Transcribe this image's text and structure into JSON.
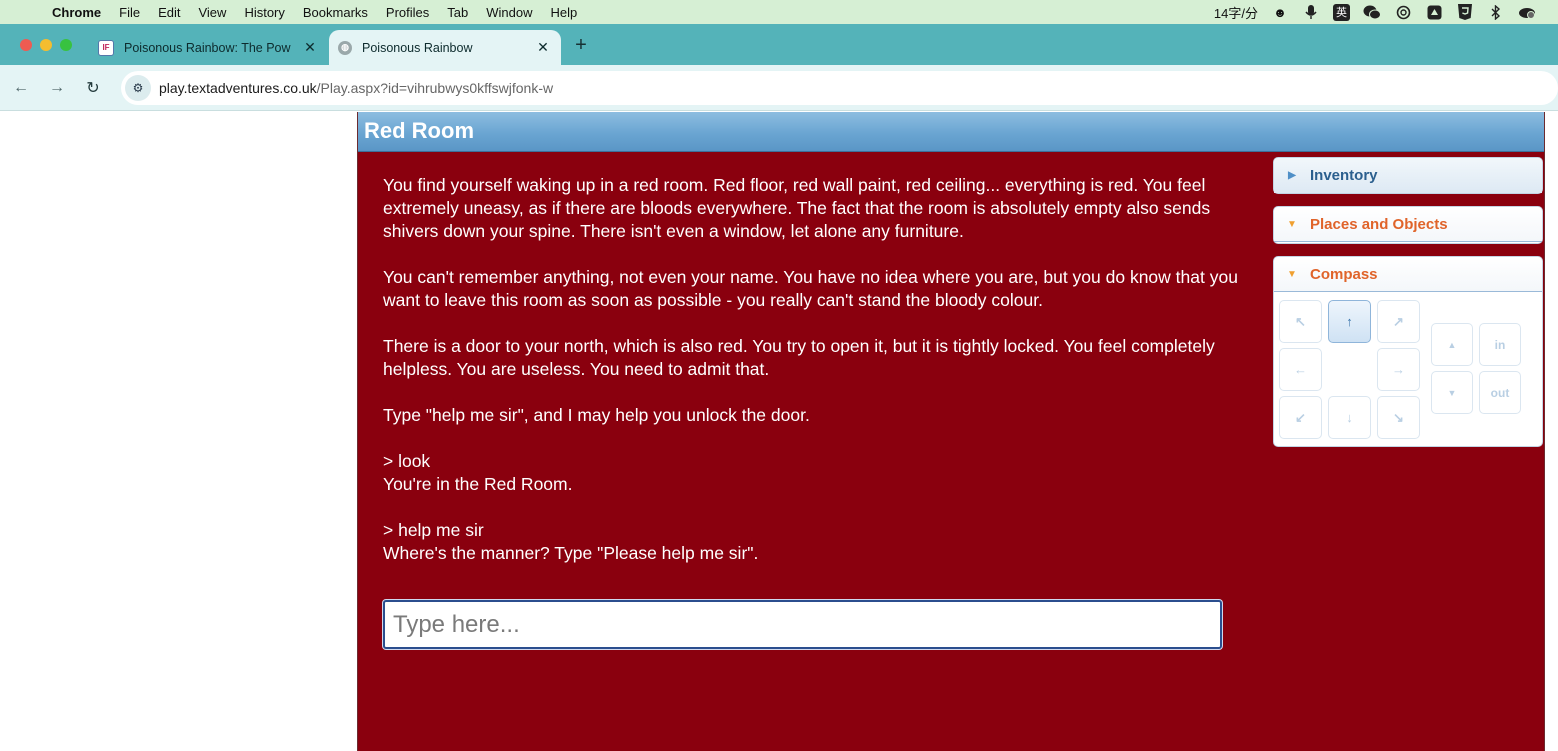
{
  "menubar": {
    "app_name": "Chrome",
    "items": [
      "File",
      "Edit",
      "View",
      "History",
      "Bookmarks",
      "Profiles",
      "Tab",
      "Window",
      "Help"
    ],
    "status_text": "14字/分",
    "ime_label": "英"
  },
  "tabs": [
    {
      "title": "Poisonous Rainbow: The Pow",
      "favicon": "IF",
      "active": false
    },
    {
      "title": "Poisonous Rainbow",
      "active": true
    }
  ],
  "toolbar": {
    "url_host": "play.textadventures.co.uk",
    "url_path": "/Play.aspx?id=vihrubwys0kffswjfonk-w"
  },
  "game": {
    "room_title": "Red Room",
    "paragraphs": [
      "You find yourself waking up in a red room. Red floor, red wall paint, red ceiling... everything is red. You feel extremely uneasy, as if there are bloods everywhere. The fact that the room is absolutely empty also sends shivers down your spine. There isn't even a window, let alone any furniture.",
      "You can't remember anything, not even your name. You have no idea where you are, but you do know that you want to leave this room as soon as possible - you really can't stand the bloody colour.",
      "There is a door to your north, which is also red. You try to open it, but it is tightly locked. You feel completely helpless. You are useless. You need to admit that.",
      "Type \"help me sir\", and I may help you unlock the door."
    ],
    "transcript": [
      {
        "command": "> look",
        "response": "You're in the Red Room."
      },
      {
        "command": "> help me sir",
        "response": "Where's the manner? Type \"Please help me sir\"."
      }
    ],
    "input_placeholder": "Type here..."
  },
  "sidebar": {
    "inventory_label": "Inventory",
    "places_label": "Places and Objects",
    "compass_label": "Compass",
    "compass": {
      "nw": "↖",
      "n": "↑",
      "ne": "↗",
      "w": "←",
      "e": "→",
      "sw": "↙",
      "s": "↓",
      "se": "↘",
      "up": "▲",
      "down": "▼",
      "in": "in",
      "out": "out"
    }
  }
}
